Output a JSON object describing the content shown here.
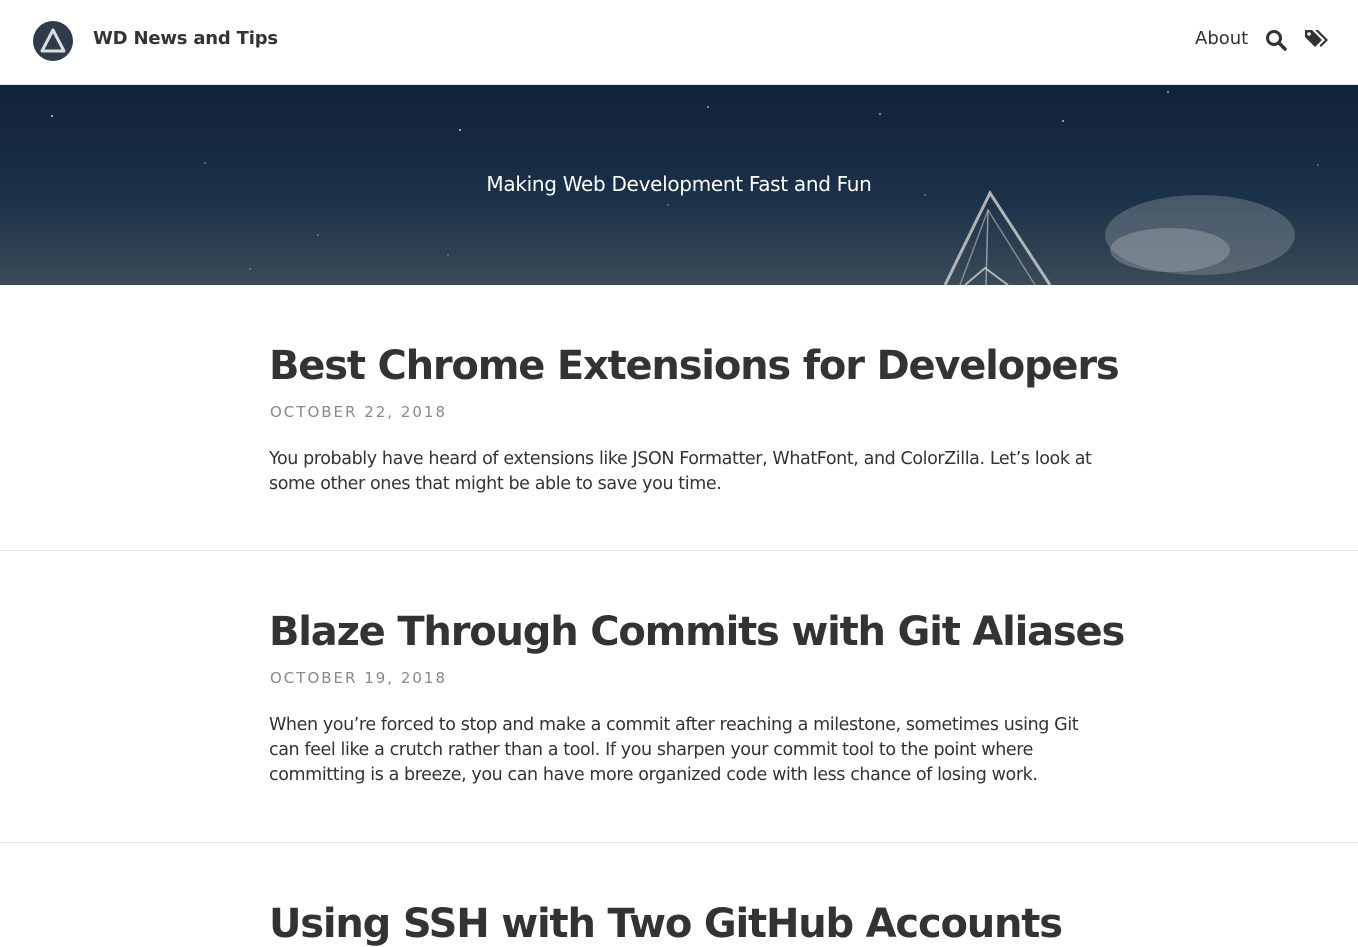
{
  "header": {
    "site_title": "WD News and Tips",
    "nav": {
      "about_label": "About"
    },
    "logo_icon": "triangle-logo-icon",
    "search_icon": "search-icon",
    "tags_icon": "tags-icon"
  },
  "hero": {
    "tagline": "Making Web Development Fast and Fun"
  },
  "posts": [
    {
      "title": "Best Chrome Extensions for Developers",
      "date": "OCTOBER 22, 2018",
      "excerpt": "You probably have heard of extensions like JSON Formatter, WhatFont, and ColorZilla. Let’s look at some other ones that might be able to save you time."
    },
    {
      "title": "Blaze Through Commits with Git Aliases",
      "date": "OCTOBER 19, 2018",
      "excerpt": "When you’re forced to stop and make a commit after reaching a milestone, sometimes using Git can feel like a crutch rather than a tool. If you sharpen your commit tool to the point where committing is a breeze, you can have more organized code with less chance of losing work."
    },
    {
      "title": "Using SSH with Two GitHub Accounts"
    }
  ],
  "colors": {
    "text": "#333333",
    "date": "#888888",
    "hero_bg": "#1b3049",
    "logo_bg": "#2f3b48"
  }
}
